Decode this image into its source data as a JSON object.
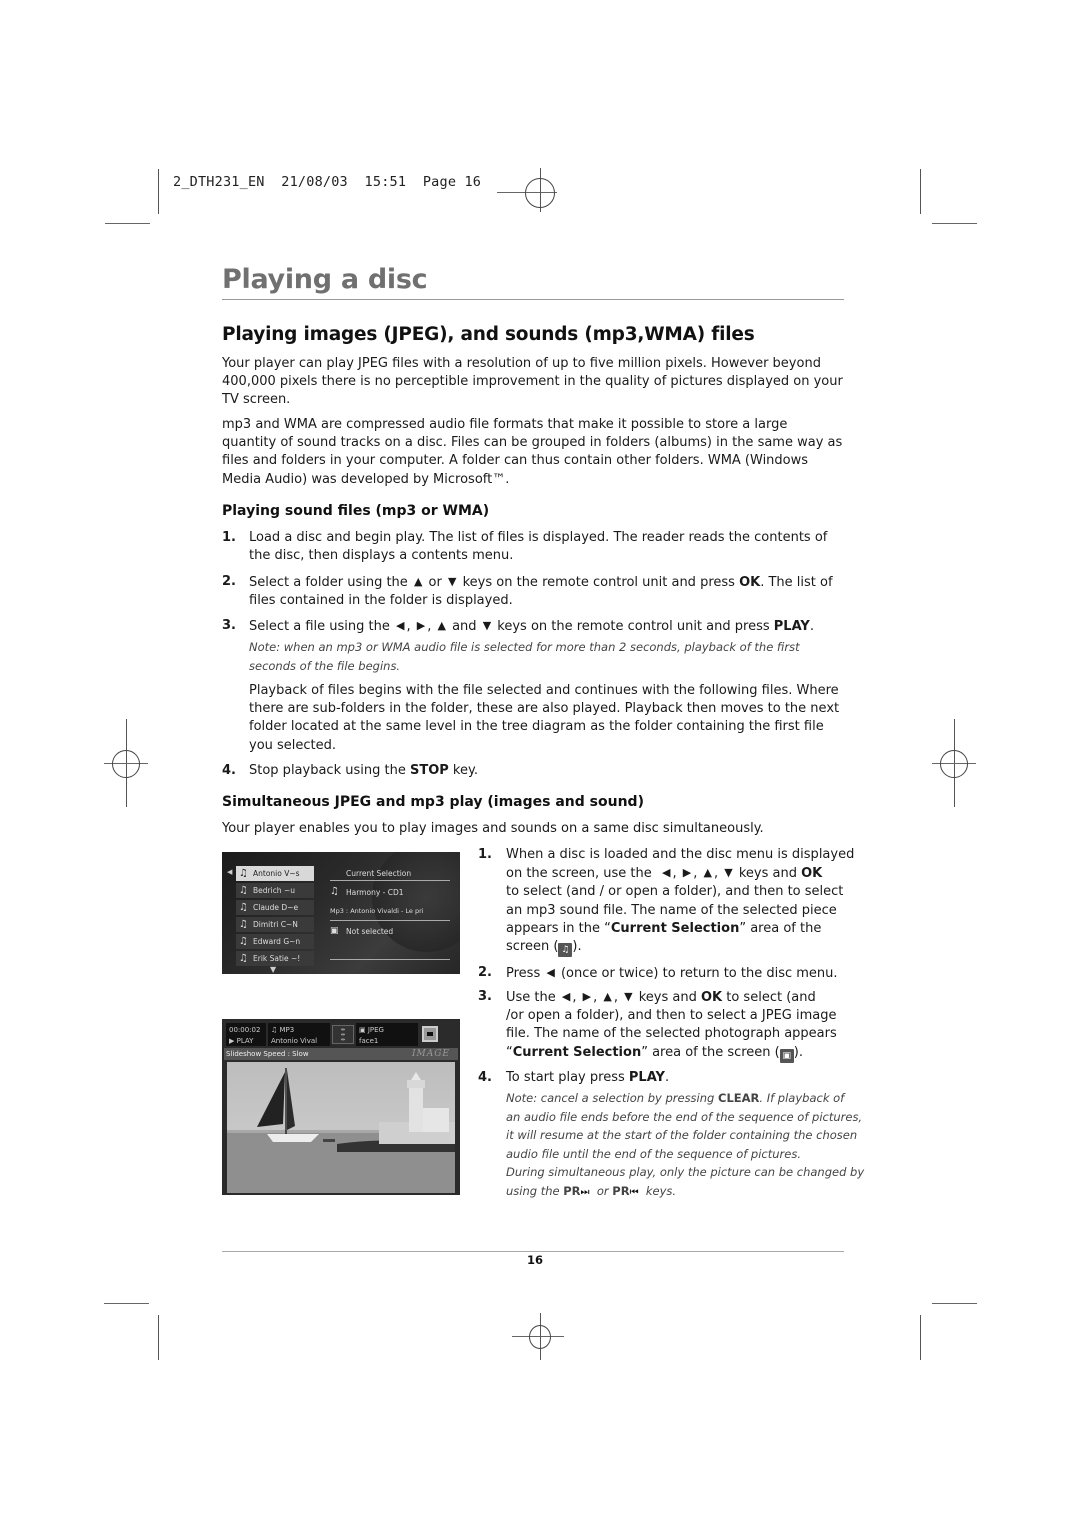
{
  "slug": {
    "text": "2_DTH231_EN  21/08/03  15:51  Page 16"
  },
  "chapter_title": "Playing a disc",
  "section_title": "Playing images (JPEG), and sounds (mp3,WMA) files",
  "intro": {
    "p1": "Your player can play JPEG files with a resolution of up to five million pixels. However beyond 400,000 pixels there is no perceptible improvement in the quality of pictures displayed on your TV screen.",
    "p2": "mp3 and WMA are compressed audio file formats that make it possible to store a large quantity of sound tracks on a disc. Files can be grouped in folders (albums) in the same way as files and folders in your computer. A folder can thus contain other folders. WMA (Windows Media Audio) was developed by Microsoft™."
  },
  "sound_section": {
    "heading": "Playing sound files (mp3 or WMA)",
    "steps": [
      {
        "num": "1.",
        "text": "Load a disc and begin play. The list of files is displayed. The reader reads the contents of the disc, then displays a contents menu."
      },
      {
        "num": "2.",
        "pre": "Select a folder using the",
        "mid": "or",
        "post": "keys on the remote control unit and press",
        "bold": "OK",
        "post2": ". The list of files contained in the folder is displayed."
      },
      {
        "num": "3.",
        "pre": "Select a file using the",
        "and": "and",
        "post": "keys on the remote control unit and press",
        "bold": "PLAY",
        "post2": "."
      },
      {
        "num": "4.",
        "pre": "Stop playback using the",
        "bold": "STOP",
        "post": "key."
      }
    ],
    "note": "Note: when an mp3 or WMA audio file is selected for more than 2 seconds, playback of the first seconds of the file begins.",
    "playback_para": "Playback of files begins with the file selected and continues with the following files. Where there are sub-folders in the folder, these are also played. Playback then moves to the next folder located at the same level in the tree diagram as the folder containing the first file you selected."
  },
  "simul_section": {
    "heading": "Simultaneous JPEG and mp3 play (images and sound)",
    "intro": "Your player enables you to play images and sounds on a same disc simultaneously.",
    "steps": [
      {
        "num": "1.",
        "l1": "When a disc is loaded and the disc menu is displayed",
        "l2_pre": "on the screen, use the",
        "l2_post": "keys and",
        "l2_bold": "OK",
        "l3": "to select (and / or open a folder), and then to select",
        "l4": "an mp3 sound file. The name of the selected piece",
        "l5_pre": "appears in the “",
        "l5_bold": "Current Selection",
        "l5_post": "” area of the",
        "l6_pre": "screen (",
        "l6_post": ")."
      },
      {
        "num": "2.",
        "pre": "Press",
        "post": "(once or twice) to return to the disc menu."
      },
      {
        "num": "3.",
        "l1_pre": "Use the",
        "l1_post": "keys and",
        "l1_bold": "OK",
        "l1_post2": "to select (and",
        "l2": "/or open a folder), and then to select a JPEG image",
        "l3": "file. The name of the selected photograph appears",
        "l4_pre": "“",
        "l4_bold": "Current Selection",
        "l4_post": "” area of the screen (",
        "l4_end": ")."
      },
      {
        "num": "4.",
        "pre": "To start play press",
        "bold": "PLAY",
        "post": "."
      }
    ],
    "note": {
      "pre": "Note: cancel a selection by pressing",
      "bold": "CLEAR",
      "l1_post": ". If playback of",
      "l2": "an audio file ends before the end of the sequence of pictures,",
      "l3": "it will resume at the start of the folder containing the chosen",
      "l4": "audio file until the end of the sequence of pictures.",
      "l5": "During simultaneous play, only the picture can be changed by",
      "l6_pre": "using the",
      "pr": "PR",
      "or": "or",
      "l6_post": "keys."
    }
  },
  "keys": {
    "left": "◀",
    "right": "▶",
    "up": "▲",
    "down": "▼",
    "next": "⏭",
    "prev": "⏮"
  },
  "screen_menu": {
    "list": [
      "Antonio V~s",
      "Bedrich ~u",
      "Claude D~e",
      "Dimitri C~N",
      "Edward G~n",
      "Erik Satie ~!"
    ],
    "selected_index": 0,
    "current_selection_title": "Current Selection",
    "audio_selection": "Harmony - CD1",
    "audio_path": "Mp3 : Antonio Vivaldi - Le pri",
    "image_selection": "Not selected"
  },
  "screen_play": {
    "time": "00:00:02",
    "status": "▶ PLAY",
    "audio_type": "♫ MP3",
    "audio_name": "Antonio Vival",
    "image_type": "JPEG",
    "image_name": "face1",
    "slideshow_speed": "Slideshow Speed : Slow",
    "mode_label": "IMAGE"
  },
  "page_number": "16"
}
